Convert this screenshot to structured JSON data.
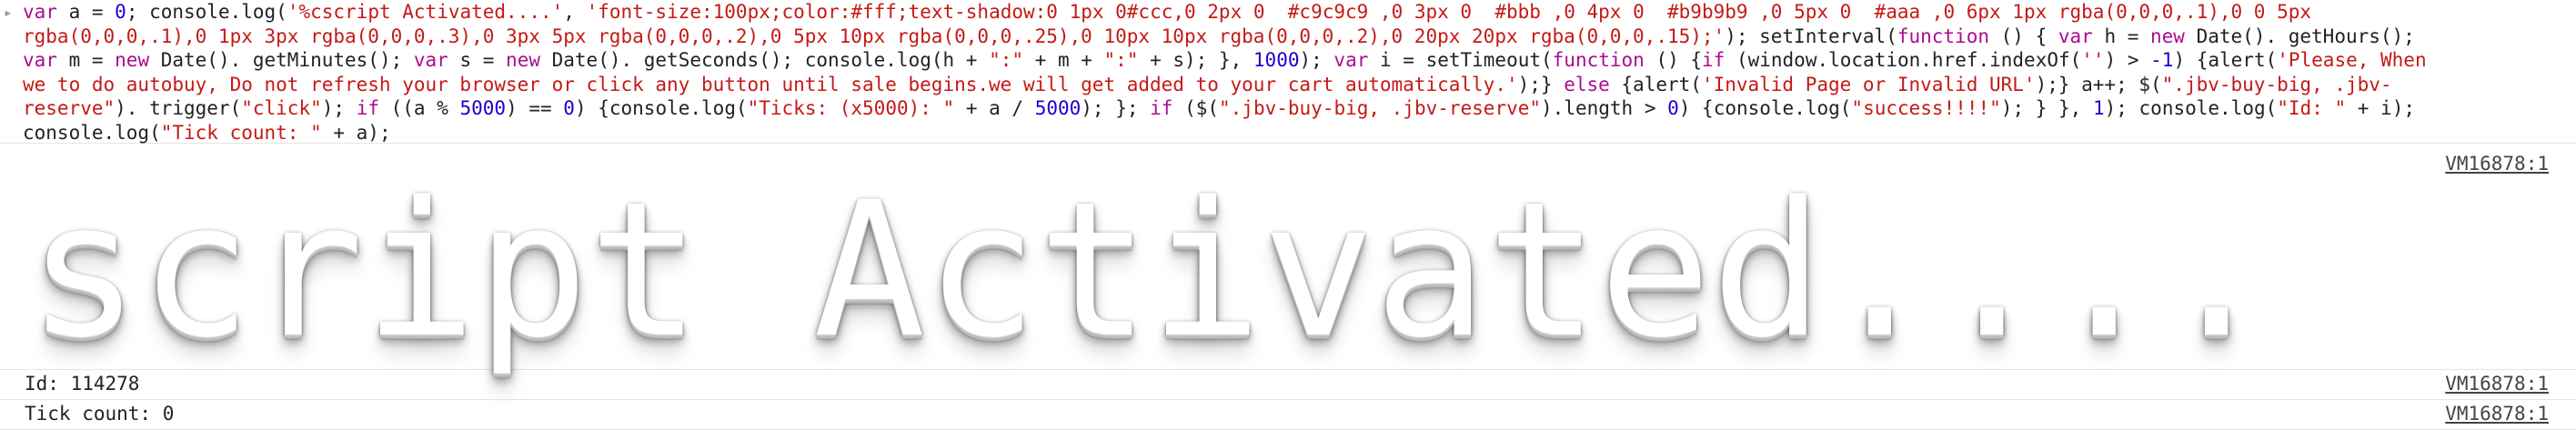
{
  "console_input": {
    "lines": [
      [
        {
          "t": "var",
          "c": "kw"
        },
        {
          "t": " a = ",
          "c": "plain"
        },
        {
          "t": "0",
          "c": "num"
        },
        {
          "t": "; console.log(",
          "c": "plain"
        },
        {
          "t": "'%cscript Activated....'",
          "c": "str"
        },
        {
          "t": ", ",
          "c": "plain"
        },
        {
          "t": "'font-size:100px;color:#fff;text-shadow:0 1px 0#ccc,0 2px 0  #c9c9c9 ,0 3px 0  #bbb ,0 4px 0  #b9b9b9 ,0 5px 0  #aaa ,0 6px 1px rgba(0,0,0,.1),0 0 5px",
          "c": "str"
        }
      ],
      [
        {
          "t": "rgba(0,0,0,.1),0 1px 3px rgba(0,0,0,.3),0 3px 5px rgba(0,0,0,.2),0 5px 10px rgba(0,0,0,.25),0 10px 10px rgba(0,0,0,.2),0 20px 20px rgba(0,0,0,.15);'",
          "c": "str"
        },
        {
          "t": "); setInterval(",
          "c": "plain"
        },
        {
          "t": "function",
          "c": "kw"
        },
        {
          "t": " () { ",
          "c": "plain"
        },
        {
          "t": "var",
          "c": "kw"
        },
        {
          "t": " h = ",
          "c": "plain"
        },
        {
          "t": "new",
          "c": "kw"
        },
        {
          "t": " Date(). getHours();",
          "c": "plain"
        }
      ],
      [
        {
          "t": "var",
          "c": "kw"
        },
        {
          "t": " m = ",
          "c": "plain"
        },
        {
          "t": "new",
          "c": "kw"
        },
        {
          "t": " Date(). getMinutes(); ",
          "c": "plain"
        },
        {
          "t": "var",
          "c": "kw"
        },
        {
          "t": " s = ",
          "c": "plain"
        },
        {
          "t": "new",
          "c": "kw"
        },
        {
          "t": " Date(). getSeconds(); console.log(h + ",
          "c": "plain"
        },
        {
          "t": "\":\"",
          "c": "str"
        },
        {
          "t": " + m + ",
          "c": "plain"
        },
        {
          "t": "\":\"",
          "c": "str"
        },
        {
          "t": " + s); }, ",
          "c": "plain"
        },
        {
          "t": "1000",
          "c": "num"
        },
        {
          "t": "); ",
          "c": "plain"
        },
        {
          "t": "var",
          "c": "kw"
        },
        {
          "t": " i = setTimeout(",
          "c": "plain"
        },
        {
          "t": "function",
          "c": "kw"
        },
        {
          "t": " () {",
          "c": "plain"
        },
        {
          "t": "if",
          "c": "kw"
        },
        {
          "t": " (window.location.href.indexOf(",
          "c": "plain"
        },
        {
          "t": "''",
          "c": "str"
        },
        {
          "t": ") > ",
          "c": "plain"
        },
        {
          "t": "-1",
          "c": "num"
        },
        {
          "t": ") {alert(",
          "c": "plain"
        },
        {
          "t": "'Please, When",
          "c": "str"
        }
      ],
      [
        {
          "t": "we to do autobuy, Do not refresh your browser or click any button until sale begins.we will get added to your cart automatically.'",
          "c": "str"
        },
        {
          "t": ");} ",
          "c": "plain"
        },
        {
          "t": "else",
          "c": "kw"
        },
        {
          "t": " {alert(",
          "c": "plain"
        },
        {
          "t": "'Invalid Page or Invalid URL'",
          "c": "str"
        },
        {
          "t": ");} a++; $(",
          "c": "plain"
        },
        {
          "t": "\".jbv-buy-big, .jbv-",
          "c": "str"
        }
      ],
      [
        {
          "t": "reserve\"",
          "c": "str"
        },
        {
          "t": "). trigger(",
          "c": "plain"
        },
        {
          "t": "\"click\"",
          "c": "str"
        },
        {
          "t": "); ",
          "c": "plain"
        },
        {
          "t": "if",
          "c": "kw"
        },
        {
          "t": " ((a % ",
          "c": "plain"
        },
        {
          "t": "5000",
          "c": "num"
        },
        {
          "t": ") == ",
          "c": "plain"
        },
        {
          "t": "0",
          "c": "num"
        },
        {
          "t": ") {console.log(",
          "c": "plain"
        },
        {
          "t": "\"Ticks: (x5000): \"",
          "c": "str"
        },
        {
          "t": " + a / ",
          "c": "plain"
        },
        {
          "t": "5000",
          "c": "num"
        },
        {
          "t": "); }; ",
          "c": "plain"
        },
        {
          "t": "if",
          "c": "kw"
        },
        {
          "t": " ($(",
          "c": "plain"
        },
        {
          "t": "\".jbv-buy-big, .jbv-reserve\"",
          "c": "str"
        },
        {
          "t": ").length > ",
          "c": "plain"
        },
        {
          "t": "0",
          "c": "num"
        },
        {
          "t": ") {console.log(",
          "c": "plain"
        },
        {
          "t": "\"success!!!!\"",
          "c": "str"
        },
        {
          "t": "); } }, ",
          "c": "plain"
        },
        {
          "t": "1",
          "c": "num"
        },
        {
          "t": "); console.log(",
          "c": "plain"
        },
        {
          "t": "\"Id: \"",
          "c": "str"
        },
        {
          "t": " + i);",
          "c": "plain"
        }
      ],
      [
        {
          "t": "console.log(",
          "c": "plain"
        },
        {
          "t": "\"Tick count: \"",
          "c": "str"
        },
        {
          "t": " + a);",
          "c": "plain"
        }
      ]
    ]
  },
  "banner": {
    "text": "script Activated....",
    "source": "VM16878:1"
  },
  "logs": [
    {
      "text": "Id: 114278",
      "source": "VM16878:1"
    },
    {
      "text": "Tick count: 0",
      "source": "VM16878:1"
    }
  ],
  "colors": {
    "keyword": "#aa0d91",
    "string": "#c41a16",
    "number": "#1c00cf"
  }
}
